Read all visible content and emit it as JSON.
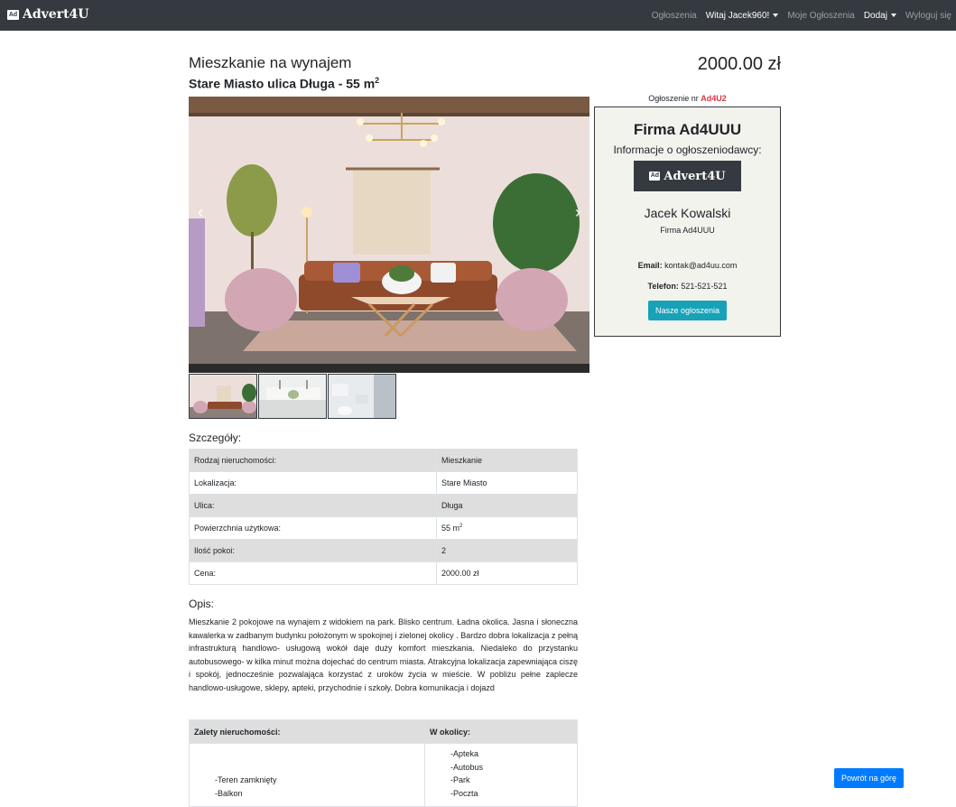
{
  "navbar": {
    "brand_badge": "Ad",
    "brand": "Advert4U",
    "links": {
      "ads": "Ogłoszenia",
      "welcome": "Witaj Jacek960!",
      "my_ads": "Moje Ogłoszenia",
      "add": "Dodaj",
      "logout": "Wyloguj się"
    }
  },
  "listing": {
    "title": "Mieszkanie na wynajem",
    "subtitle_main": "Stare Miasto ulica Długa - 55 m",
    "subtitle_sup": "2",
    "price": "2000.00 zł",
    "ad_number_label": "Ogłoszenie nr",
    "ad_number": "Ad4U2"
  },
  "carousel": {
    "prev_label": "‹",
    "next_label": "›",
    "images": [
      "living-room",
      "kitchen",
      "bathroom"
    ]
  },
  "advertiser": {
    "company": "Firma Ad4UUU",
    "info_label": "Informacje o ogłoszeniodawcy:",
    "logo_badge": "Ad",
    "logo_text": "Advert4U",
    "person": "Jacek Kowalski",
    "company_small": "Firma Ad4UUU",
    "email_label": "Email:",
    "email": "kontak@ad4uu.com",
    "phone_label": "Telefon:",
    "phone": "521-521-521",
    "ads_button": "Nasze ogloszenia"
  },
  "details": {
    "heading": "Szczegóły:",
    "rows": [
      {
        "label": "Rodzaj nieruchomości:",
        "value": "Mieszkanie"
      },
      {
        "label": "Lokalizacja:",
        "value": "Stare Miasto"
      },
      {
        "label": "Ulica:",
        "value": "Długa"
      },
      {
        "label": "Powierzchnia użytkowa:",
        "value": "55 m",
        "sup": "2"
      },
      {
        "label": "Ilość pokoi:",
        "value": "2"
      },
      {
        "label": "Cena:",
        "value": "2000.00 zł"
      }
    ]
  },
  "description": {
    "heading": "Opis:",
    "text": "Mieszkanie 2 pokojowe na wynajem z widokiem na park. Blisko centrum. Ładna okolica. Jasna i słoneczna kawalerka w zadbanym budynku położonym w spokojnej i zielonej okolicy . Bardzo dobra lokalizacja z pełną infrastrukturą handlowo- usługową wokół daje duży komfort mieszkania. Niedaleko do przystanku autobusowego- w kilka minut można dojechać do centrum miasta. Atrakcyjna lokalizacja zapewniająca ciszę i spokój, jednocześnie pozwalająca korzystać z uroków życia w mieście. W pobliżu pełne zaplecze handlowo-usługowe, sklepy, apteki, przychodnie i szkoły. Dobra komunikacja i dojazd"
  },
  "features": {
    "advantages_heading": "Zalety nieruchomości:",
    "nearby_heading": "W okolicy:",
    "advantages": [
      "-Teren zamknięty",
      "-Balkon"
    ],
    "nearby": [
      "-Apteka",
      "-Autobus",
      "-Park",
      "-Poczta"
    ]
  },
  "back_to_top": "Powrót na górę"
}
